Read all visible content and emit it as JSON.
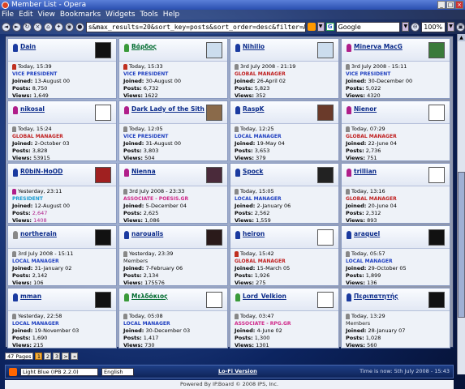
{
  "window": {
    "title": "Member List - Opera"
  },
  "menu": [
    "File",
    "Edit",
    "View",
    "Bookmarks",
    "Widgets",
    "Tools",
    "Help"
  ],
  "toolbar": {
    "url": "s&max_results=20&sort_key=posts&sort_order=desc&filter=ALL",
    "search": "Google",
    "zoom": "100%"
  },
  "members": [
    {
      "name": "Dain",
      "name_color": "#0b2b8a",
      "icon_color": "#1a3aa0",
      "last": "Today, 15:39",
      "last_icon": "#c03020",
      "group": "VICE PRESIDENT",
      "group_color": "#2040c0",
      "joined": "13-August 00",
      "posts": "8,750",
      "views": "1,649",
      "avatar": "#111"
    },
    {
      "name": "Βάρδος",
      "name_color": "#006b2e",
      "icon_color": "#3a9a3a",
      "last": "Today, 15:33",
      "last_icon": "#c03020",
      "group": "VICE PRESIDENT",
      "group_color": "#2040c0",
      "joined": "30-August 00",
      "posts": "6,732",
      "views": "1622",
      "avatar": "#cde"
    },
    {
      "name": "Nihilio",
      "name_color": "#0b2b8a",
      "icon_color": "#1a3aa0",
      "last": "3rd July 2008 - 21:19",
      "last_icon": "#888",
      "group": "GLOBAL MANAGER",
      "group_color": "#c02020",
      "joined": "26-April 02",
      "posts": "5,823",
      "views": "352",
      "avatar": "#cde"
    },
    {
      "name": "Minerva MacG",
      "name_color": "#0b2b8a",
      "icon_color": "#b01e8a",
      "last": "3rd July 2008 - 15:11",
      "last_icon": "#888",
      "group": "VICE PRESIDENT",
      "group_color": "#2040c0",
      "joined": "30-December 00",
      "posts": "5,022",
      "views": "4320",
      "avatar": "#3a7a3a"
    },
    {
      "name": "nikosal",
      "name_color": "#0b2b8a",
      "icon_color": "#b01e8a",
      "last": "Today, 15:24",
      "last_icon": "#888",
      "group": "GLOBAL MANAGER",
      "group_color": "#c02020",
      "joined": "2-October 03",
      "posts": "3,828",
      "views": "53915",
      "avatar": "#fff"
    },
    {
      "name": "Dark Lady of the Sith",
      "name_color": "#0b2b8a",
      "icon_color": "#b01e8a",
      "last": "Today, 12:05",
      "last_icon": "#888",
      "group": "VICE PRESIDENT",
      "group_color": "#2040c0",
      "joined": "31-August 00",
      "posts": "3,803",
      "views": "504",
      "avatar": "#8a6a4a"
    },
    {
      "name": "RaspK",
      "name_color": "#0b2b8a",
      "icon_color": "#1a3aa0",
      "last": "Today, 12:25",
      "last_icon": "#888",
      "group": "LOCAL MANAGER",
      "group_color": "#2040c0",
      "joined": "19-May 04",
      "posts": "3,653",
      "views": "379",
      "avatar": "#6a3a2a"
    },
    {
      "name": "Nienor",
      "name_color": "#0b2b8a",
      "icon_color": "#b01e8a",
      "last": "Today, 07:29",
      "last_icon": "#888",
      "group": "GLOBAL MANAGER",
      "group_color": "#c02020",
      "joined": "22-June 04",
      "posts": "2,736",
      "views": "751",
      "avatar": "#fff"
    },
    {
      "name": "R0biN-HoOD",
      "name_color": "#0b2b8a",
      "icon_color": "#1a3aa0",
      "last": "Yesterday, 23:11",
      "last_icon": "#b01e8a",
      "group": "PRESIDENT",
      "group_color": "#1a9ad0",
      "joined": "12-August 00",
      "posts": "2,647",
      "views": "1408",
      "avatar": "#a02020",
      "posts_color": "#b01e8a",
      "views_color": "#b01e8a"
    },
    {
      "name": "Nienna",
      "name_color": "#0b2b8a",
      "icon_color": "#b01e8a",
      "last": "3rd July 2008 - 23:33",
      "last_icon": "#888",
      "group": "ASSOCIATE - POESIS.GR",
      "group_color": "#d02a8a",
      "joined": "5-December 04",
      "posts": "2,625",
      "views": "1,086",
      "avatar": "#4a2a3a"
    },
    {
      "name": "Spock",
      "name_color": "#0b2b8a",
      "icon_color": "#1a3aa0",
      "last": "Today, 15:05",
      "last_icon": "#888",
      "group": "LOCAL MANAGER",
      "group_color": "#2040c0",
      "joined": "2-January 06",
      "posts": "2,562",
      "views": "1,559",
      "avatar": "#222"
    },
    {
      "name": "trillian",
      "name_color": "#0b2b8a",
      "icon_color": "#b01e8a",
      "last": "Today, 13:16",
      "last_icon": "#888",
      "group": "GLOBAL MANAGER",
      "group_color": "#c02020",
      "joined": "20-June 04",
      "posts": "2,312",
      "views": "893",
      "avatar": "#fff"
    },
    {
      "name": "northerain",
      "name_color": "#0b2b8a",
      "icon_color": "#888",
      "last": "3rd July 2008 - 15:11",
      "last_icon": "#888",
      "group": "LOCAL MANAGER",
      "group_color": "#2040c0",
      "joined": "31-January 02",
      "posts": "2,142",
      "views": "106",
      "avatar": "#111"
    },
    {
      "name": "naroualis",
      "name_color": "#0b2b8a",
      "icon_color": "#1a3aa0",
      "last": "Yesterday, 23:39",
      "last_icon": "#888",
      "group": "Members",
      "group_color": "#222",
      "joined": "7-February 06",
      "posts": "2,134",
      "views": "175576",
      "avatar": "#2a1a1a",
      "group_plain": true
    },
    {
      "name": "heiron",
      "name_color": "#0b2b8a",
      "icon_color": "#1a3aa0",
      "last": "Today, 15:42",
      "last_icon": "#c03020",
      "group": "GLOBAL MANAGER",
      "group_color": "#c02020",
      "joined": "15-March 05",
      "posts": "1,926",
      "views": "275",
      "avatar": "#fff"
    },
    {
      "name": "araquel",
      "name_color": "#0b2b8a",
      "icon_color": "#1a3aa0",
      "last": "Today, 05:57",
      "last_icon": "#888",
      "group": "LOCAL MANAGER",
      "group_color": "#2040c0",
      "joined": "29-October 05",
      "posts": "1,899",
      "views": "136",
      "avatar": "#111"
    },
    {
      "name": "mman",
      "name_color": "#0b2b8a",
      "icon_color": "#1a3aa0",
      "last": "Yesterday, 22:58",
      "last_icon": "#888",
      "group": "LOCAL MANAGER",
      "group_color": "#2040c0",
      "joined": "19-November 03",
      "posts": "1,690",
      "views": "215",
      "avatar": "#111"
    },
    {
      "name": "Μελδόκιος",
      "name_color": "#006b2e",
      "icon_color": "#3a9a3a",
      "last": "Today, 05:08",
      "last_icon": "#888",
      "group": "LOCAL MANAGER",
      "group_color": "#2040c0",
      "joined": "30-December 03",
      "posts": "1,417",
      "views": "730",
      "avatar": "#fff"
    },
    {
      "name": "Lord_Velkion",
      "name_color": "#0b2b8a",
      "icon_color": "#3a9a3a",
      "last": "Today, 03:47",
      "last_icon": "#888",
      "group": "ASSOCIATE - RPG.GR",
      "group_color": "#d02a8a",
      "joined": "4-June 02",
      "posts": "1,300",
      "views": "1301",
      "avatar": "#fff"
    },
    {
      "name": "Περιπατητής",
      "name_color": "#0b2b8a",
      "icon_color": "#1a3aa0",
      "last": "Today, 13:29",
      "last_icon": "#888",
      "group": "Members",
      "group_color": "#222",
      "joined": "28-January 07",
      "posts": "1,028",
      "views": "560",
      "avatar": "#111",
      "group_plain": true
    }
  ],
  "labels": {
    "joined": "Joined:",
    "posts": "Posts:",
    "views": "Views:"
  },
  "pagination": {
    "count": "47 Pages",
    "pages": [
      "1",
      "2",
      "3"
    ],
    "next": ">",
    "last": "»"
  },
  "footer": {
    "skin": "Light Blue (IPB 2.2.0)",
    "lang": "English",
    "lofi": "Lo-Fi Version",
    "time": "Time is now: 5th July 2008 - 15:43",
    "powered": "Powered By IP.Board © 2008  IPS, Inc."
  }
}
